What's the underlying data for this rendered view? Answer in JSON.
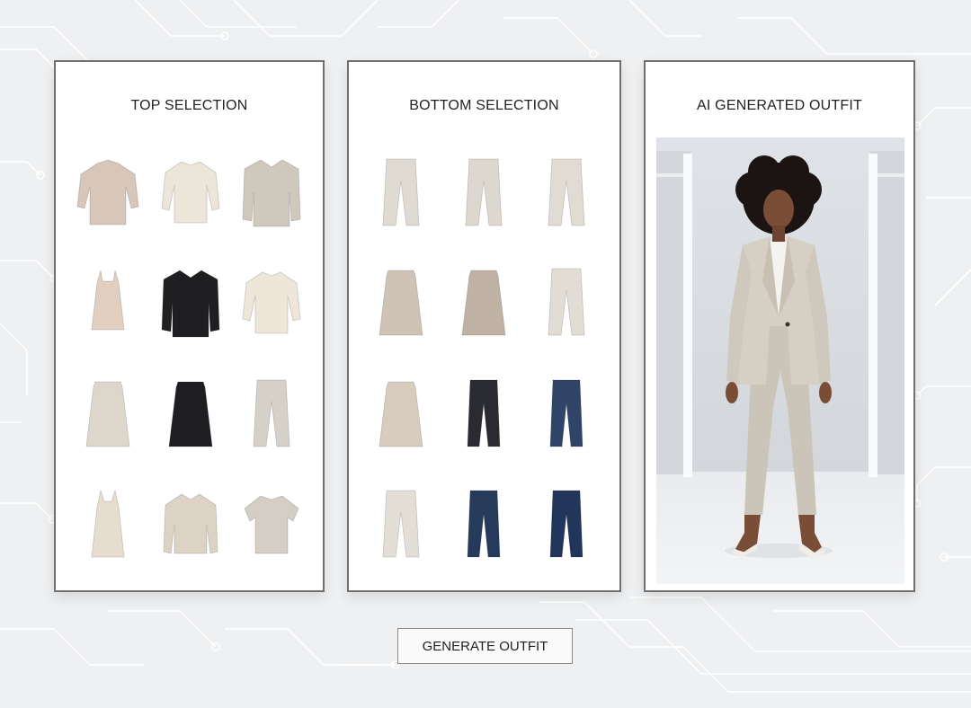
{
  "panels": {
    "top": {
      "title": "TOP SELECTION"
    },
    "bottom": {
      "title": "BOTTOM SELECTION"
    },
    "result": {
      "title": "AI GENERATED OUTFIT"
    }
  },
  "top_items": [
    {
      "icon": "blouse-icon",
      "color": "#d8c6b8"
    },
    {
      "icon": "shirt-icon",
      "color": "#ece6da"
    },
    {
      "icon": "blazer-icon",
      "color": "#cfc8bd"
    },
    {
      "icon": "camisole-icon",
      "color": "#e2cfc0"
    },
    {
      "icon": "blazer-icon",
      "color": "#1f1f22"
    },
    {
      "icon": "shirt-icon",
      "color": "#ede6d9"
    },
    {
      "icon": "skirt-icon",
      "color": "#ddd6cb"
    },
    {
      "icon": "skirt-icon",
      "color": "#1e1e22"
    },
    {
      "icon": "trousers-icon",
      "color": "#d6d1c8"
    },
    {
      "icon": "dress-icon",
      "color": "#e6ddce"
    },
    {
      "icon": "jacket-icon",
      "color": "#dcd3c5"
    },
    {
      "icon": "tshirt-icon",
      "color": "#d4cec5"
    }
  ],
  "bottom_items": [
    {
      "icon": "trousers-icon",
      "color": "#e0dbd2"
    },
    {
      "icon": "trousers-icon",
      "color": "#ddd8cf"
    },
    {
      "icon": "trousers-icon",
      "color": "#e1dcd3"
    },
    {
      "icon": "skirt-icon",
      "color": "#cfc3b7"
    },
    {
      "icon": "skirt-icon",
      "color": "#bfb2a4"
    },
    {
      "icon": "trousers-icon",
      "color": "#e2ddd4"
    },
    {
      "icon": "skirt-icon",
      "color": "#d8ccbe"
    },
    {
      "icon": "jeans-icon",
      "color": "#2a2b30"
    },
    {
      "icon": "jeans-icon",
      "color": "#2f4466"
    },
    {
      "icon": "trousers-icon",
      "color": "#e4dfd6"
    },
    {
      "icon": "jeans-icon",
      "color": "#263a5c"
    },
    {
      "icon": "jeans-icon",
      "color": "#22355a"
    }
  ],
  "button": {
    "label": "GENERATE OUTFIT"
  },
  "colors": {
    "background": "#eef0f2",
    "panel_border": "#6f6f6f",
    "circuit": "#ffffff"
  }
}
